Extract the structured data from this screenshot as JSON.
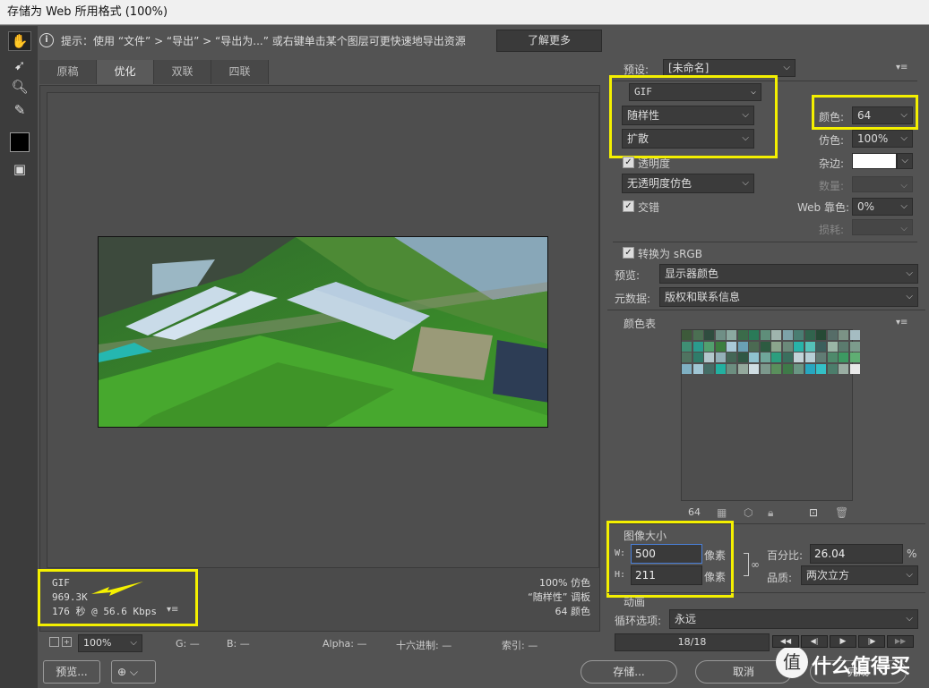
{
  "window": {
    "title": "存储为 Web 所用格式 (100%)"
  },
  "toolbar": {
    "icons": [
      "hand-icon",
      "slice-select-icon",
      "zoom-icon",
      "eyedropper-icon",
      "color-swatch",
      "toggle-slices-icon"
    ]
  },
  "hint": {
    "text": "提示：使用 “文件” > “导出” > “导出为...” 或右键单击某个图层可更快速地导出资源",
    "learn_more": "了解更多"
  },
  "tabs": [
    "原稿",
    "优化",
    "双联",
    "四联"
  ],
  "canvas_info": {
    "left": [
      "GIF",
      "969.3K",
      "176 秒 @ 56.6 Kbps"
    ],
    "right": [
      "100% 仿色",
      "“随样性” 调板",
      "64 颜色"
    ]
  },
  "bottom": {
    "zoom": "100%",
    "g": "G: —",
    "b": "B: —",
    "alpha": "Alpha: —",
    "hex": "十六进制: —",
    "index": "索引: —"
  },
  "buttons": {
    "preview": "预览...",
    "save": "存储...",
    "cancel": "取消",
    "done": "完成"
  },
  "settings": {
    "preset_label": "预设:",
    "preset_value": "[未命名]",
    "format": "GIF",
    "reduction": "随样性",
    "dither": "扩散",
    "colors_label": "颜色:",
    "colors_value": "64",
    "dither_label": "仿色:",
    "dither_value": "100%",
    "transparency_label": "透明度",
    "matte_label": "杂边:",
    "no_transparency_dither": "无透明度仿色",
    "amount_label": "数量:",
    "interlaced_label": "交错",
    "web_snap_label": "Web 靠色:",
    "web_snap_value": "0%",
    "lossy_label": "损耗:",
    "convert_srgb": "转换为 sRGB",
    "preview_label": "预览:",
    "preview_value": "显示器颜色",
    "metadata_label": "元数据:",
    "metadata_value": "版权和联系信息"
  },
  "color_table": {
    "title": "颜色表",
    "count": "64"
  },
  "image_size": {
    "title": "图像大小",
    "w_label": "W:",
    "w_value": "500",
    "h_label": "H:",
    "h_value": "211",
    "unit": "像素",
    "percent_label": "百分比:",
    "percent_value": "26.04",
    "percent_unit": "%",
    "quality_label": "品质:",
    "quality_value": "两次立方"
  },
  "animation": {
    "title": "动画",
    "loop_label": "循环选项:",
    "loop_value": "永远",
    "frame": "18/18"
  },
  "watermark": "什么值得买",
  "colors": {
    "highlight": "#f4f000",
    "panel": "#535353"
  }
}
